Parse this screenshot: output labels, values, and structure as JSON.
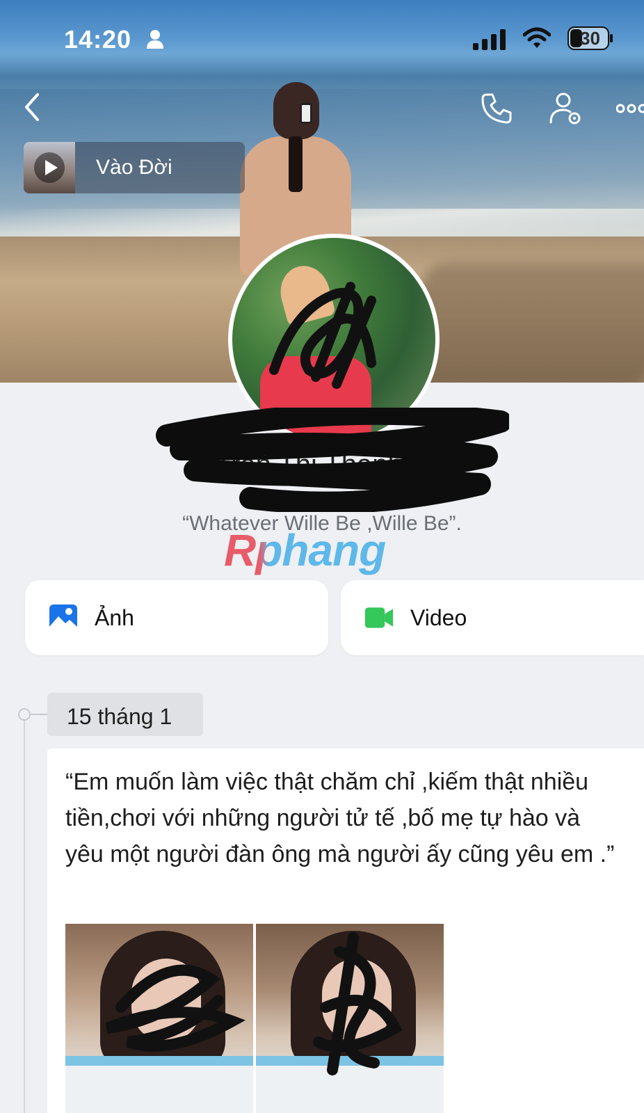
{
  "status_bar": {
    "time": "14:20",
    "battery": "30"
  },
  "music": {
    "title": "Vào Đời"
  },
  "profile": {
    "name": "Trần Thị Thanh Nhi",
    "status": "“Whatever Wille Be ,Wille Be”."
  },
  "watermark": "Rphang",
  "media": {
    "photos_label": "Ảnh",
    "video_label": "Video"
  },
  "timeline": {
    "date": "15 tháng 1",
    "post_text": "“Em muốn làm việc thật chăm chỉ ,kiếm thật nhiều tiền,chơi với những người tử tế ,bố mẹ tự hào và yêu một người đàn ông mà người ấy cũng yêu em .”"
  },
  "colors": {
    "photos_icon": "#1a73e8",
    "video_icon": "#34c759",
    "chip_bg": "#dfe1e5"
  },
  "icons": [
    "person-icon",
    "signal-icon",
    "wifi-icon",
    "battery-icon",
    "back-icon",
    "phone-icon",
    "user-settings-icon",
    "more-icon",
    "play-icon",
    "photo-icon",
    "video-camera-icon",
    "edit-pencil-icon"
  ]
}
